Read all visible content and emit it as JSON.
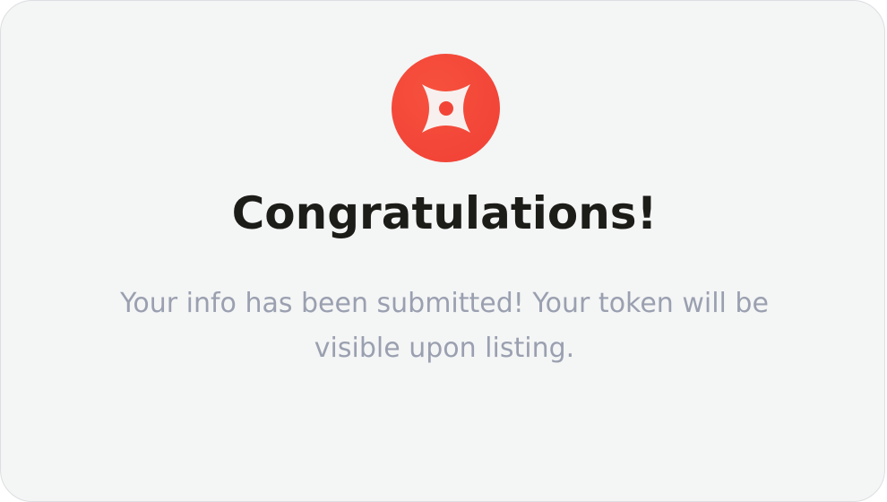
{
  "success_card": {
    "logo_icon": "four-point-star-icon",
    "accent_color": "#f24538",
    "title": "Congratulations!",
    "message": "Your info has been submitted! Your token will be visible upon listing."
  }
}
